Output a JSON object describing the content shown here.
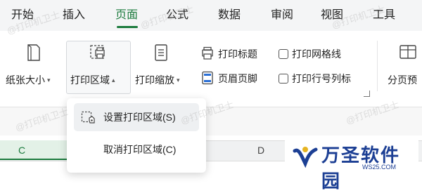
{
  "tabs": [
    {
      "label": "开始",
      "active": false
    },
    {
      "label": "插入",
      "active": false
    },
    {
      "label": "页面",
      "active": true
    },
    {
      "label": "公式",
      "active": false
    },
    {
      "label": "数据",
      "active": false
    },
    {
      "label": "审阅",
      "active": false
    },
    {
      "label": "视图",
      "active": false
    },
    {
      "label": "工具",
      "active": false
    }
  ],
  "ribbon": {
    "paper_size": "纸张大小",
    "print_area": "打印区域",
    "print_scale": "打印缩放",
    "print_title": "打印标题",
    "header_footer": "页眉页脚",
    "print_gridlines": {
      "label": "打印网格线",
      "checked": false
    },
    "print_row_col_labels": {
      "label": "打印行号列标",
      "checked": false
    },
    "page_break_preview": "分页预"
  },
  "dropdown": {
    "set_print_area": "设置打印区域(S)",
    "cancel_print_area": "取消打印区域(C)"
  },
  "sheet": {
    "columns": [
      "C",
      "D"
    ]
  },
  "watermark": "@打印机卫士",
  "logo": {
    "text": "万圣软件园",
    "url_text": "WS25.COM"
  },
  "colors": {
    "accent": "#1a7a3c",
    "logo_blue": "#1c3f94"
  }
}
